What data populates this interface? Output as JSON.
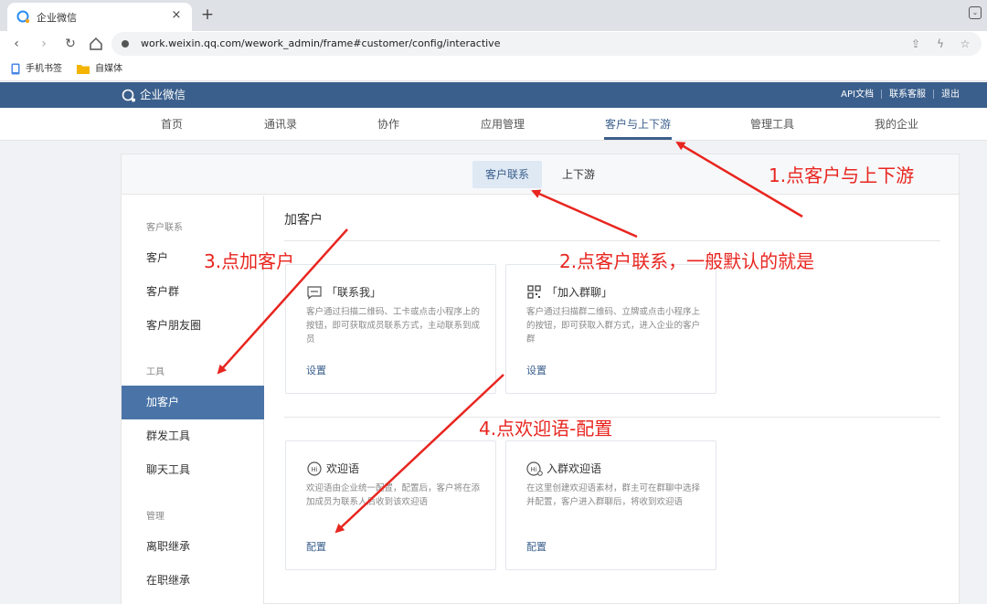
{
  "browser": {
    "tab_title": "企业微信",
    "tab_close": "×",
    "new_tab": "+",
    "url": "work.weixin.qq.com/wework_admin/frame#customer/config/interactive",
    "bookmarks": [
      "手机书签",
      "自媒体"
    ]
  },
  "header": {
    "logo_text": "企业微信",
    "links": [
      "API文档",
      "联系客服",
      "退出"
    ]
  },
  "main_nav": {
    "items": [
      "首页",
      "通讯录",
      "协作",
      "应用管理",
      "客户与上下游",
      "管理工具",
      "我的企业"
    ],
    "active": "客户与上下游"
  },
  "subtabs": {
    "items": [
      "客户联系",
      "上下游"
    ],
    "active": "客户联系"
  },
  "sidebar": {
    "groups": [
      {
        "label": "客户联系",
        "items": [
          "客户",
          "客户群",
          "客户朋友圈"
        ]
      },
      {
        "label": "工具",
        "items": [
          "加客户",
          "群发工具",
          "聊天工具"
        ]
      },
      {
        "label": "管理",
        "items": [
          "离职继承",
          "在职继承"
        ]
      }
    ],
    "active": "加客户"
  },
  "main": {
    "title": "加客户",
    "cards": [
      {
        "icon": "message-icon",
        "title": "「联系我」",
        "desc": "客户通过扫描二维码、工卡或点击小程序上的按钮，即可获取成员联系方式，主动联系到成员",
        "link": "设置"
      },
      {
        "icon": "qrcode-icon",
        "title": "「加入群聊」",
        "desc": "客户通过扫描群二维码、立牌或点击小程序上的按钮，即可获取入群方式，进入企业的客户群",
        "link": "设置"
      },
      {
        "icon": "hi-icon",
        "title": "欢迎语",
        "desc": "欢迎语由企业统一配置，配置后，客户将在添加成员为联系人后收到该欢迎语",
        "link": "配置"
      },
      {
        "icon": "hi-group-icon",
        "title": "入群欢迎语",
        "desc": "在这里创建欢迎语素材，群主可在群聊中选择并配置，客户进入群聊后，将收到欢迎语",
        "link": "配置"
      }
    ]
  },
  "annotations": {
    "step1": "1.点客户与上下游",
    "step2": "2.点客户联系，一般默认的就是",
    "step3": "3.点加客户",
    "step4": "4.点欢迎语-配置",
    "color": "#e8251f"
  },
  "colors": {
    "header_bg": "#3b5f8c",
    "sidebar_active": "#4a74a8",
    "link": "#3b5f8c"
  }
}
